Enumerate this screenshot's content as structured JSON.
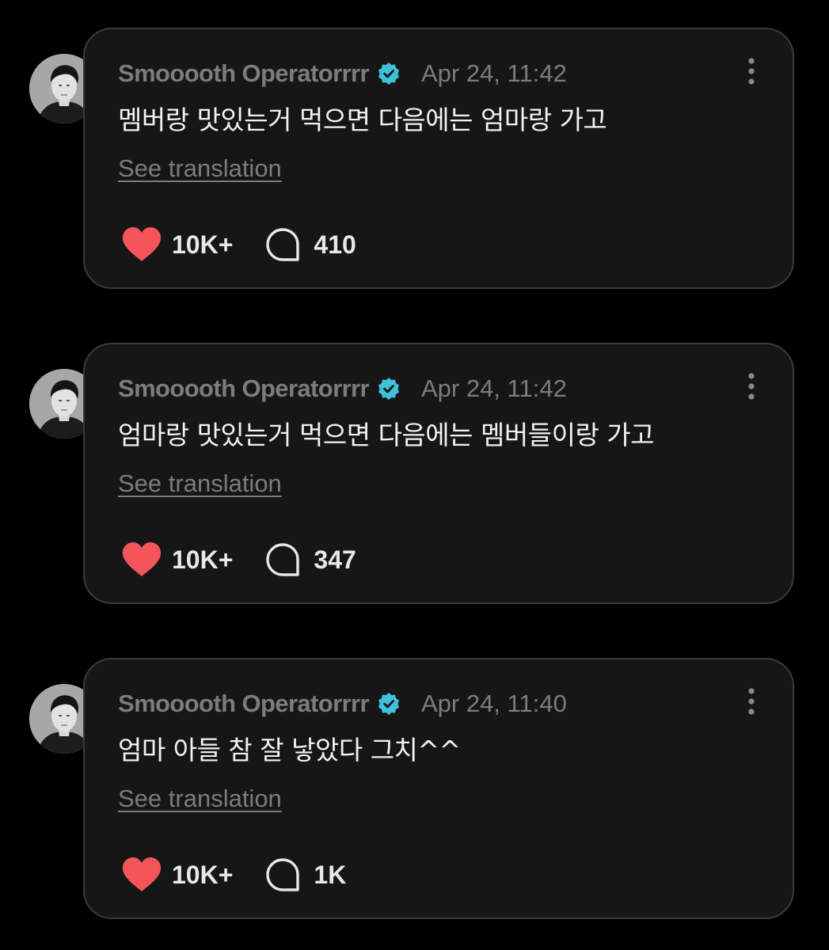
{
  "colors": {
    "background": "#000000",
    "card": "#161616",
    "card_border": "#3a3a3a",
    "muted_text": "#7c7c7c",
    "body_text": "#f2f2f2",
    "heart": "#f4555a",
    "verified": "#3fc1dc"
  },
  "icons": {
    "like": "heart-icon",
    "comment": "speech-bubble-icon",
    "verified": "verified-badge-icon",
    "more": "more-vertical-icon"
  },
  "posts": [
    {
      "author": "Smooooth Operatorrrr",
      "timestamp": "Apr 24, 11:42",
      "text": "멤버랑 맛있는거 먹으면 다음에는 엄마랑 가고",
      "translate_label": "See translation",
      "likes": "10K+",
      "comments": "410"
    },
    {
      "author": "Smooooth Operatorrrr",
      "timestamp": "Apr 24, 11:42",
      "text": "엄마랑 맛있는거 먹으면 다음에는 멤버들이랑 가고",
      "translate_label": "See translation",
      "likes": "10K+",
      "comments": "347"
    },
    {
      "author": "Smooooth Operatorrrr",
      "timestamp": "Apr 24, 11:40",
      "text": "엄마 아들 참 잘 낳았다 그치^^",
      "translate_label": "See translation",
      "likes": "10K+",
      "comments": "1K"
    }
  ]
}
